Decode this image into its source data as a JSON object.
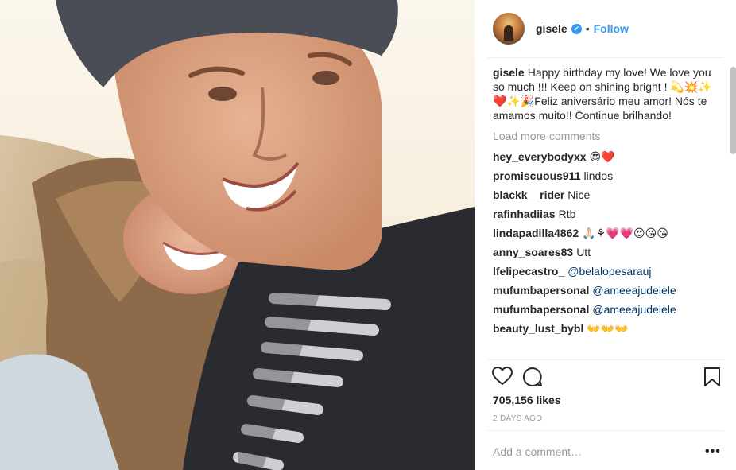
{
  "post": {
    "author": "gisele",
    "verified_mark": "✔",
    "separator": "•",
    "follow_label": "Follow"
  },
  "caption": {
    "username": "gisele",
    "text": "Happy birthday my love! We love you so much !!! Keep on shining bright ! 💫💥✨❤️✨🎉Feliz aniversário meu amor! Nós te amamos muito!! Continue brilhando!"
  },
  "load_more_label": "Load more comments",
  "comments": [
    {
      "username": "hey_everybodyxx",
      "text": "😍❤️"
    },
    {
      "username": "promiscuous911",
      "text": "lindos"
    },
    {
      "username": "blackk__rider",
      "text": "Nice"
    },
    {
      "username": "rafinhadiias",
      "text": "Rtb"
    },
    {
      "username": "lindapadilla4862",
      "text": "🙏🏻⚘💗💗😍😘😘"
    },
    {
      "username": "anny_soares83",
      "text": "Utt"
    },
    {
      "username": "lfelipecastro_",
      "text": "@belalopesarauj"
    },
    {
      "username": "mufumbapersonal",
      "text": "@ameeajudelele"
    },
    {
      "username": "mufumbapersonal",
      "text": "@ameeajudelele"
    },
    {
      "username": "beauty_lust_bybl",
      "text": "👐👐👐"
    }
  ],
  "actions": {
    "like_icon": "heart-outline-icon",
    "comment_icon": "speech-bubble-icon",
    "save_icon": "bookmark-icon"
  },
  "likes_label": "705,156 likes",
  "timestamp": "2 DAYS AGO",
  "add_comment_placeholder": "Add a comment…",
  "more_label": "•••",
  "colors": {
    "link": "#3897f0",
    "mention": "#003569",
    "muted": "#999999",
    "text": "#262626"
  }
}
